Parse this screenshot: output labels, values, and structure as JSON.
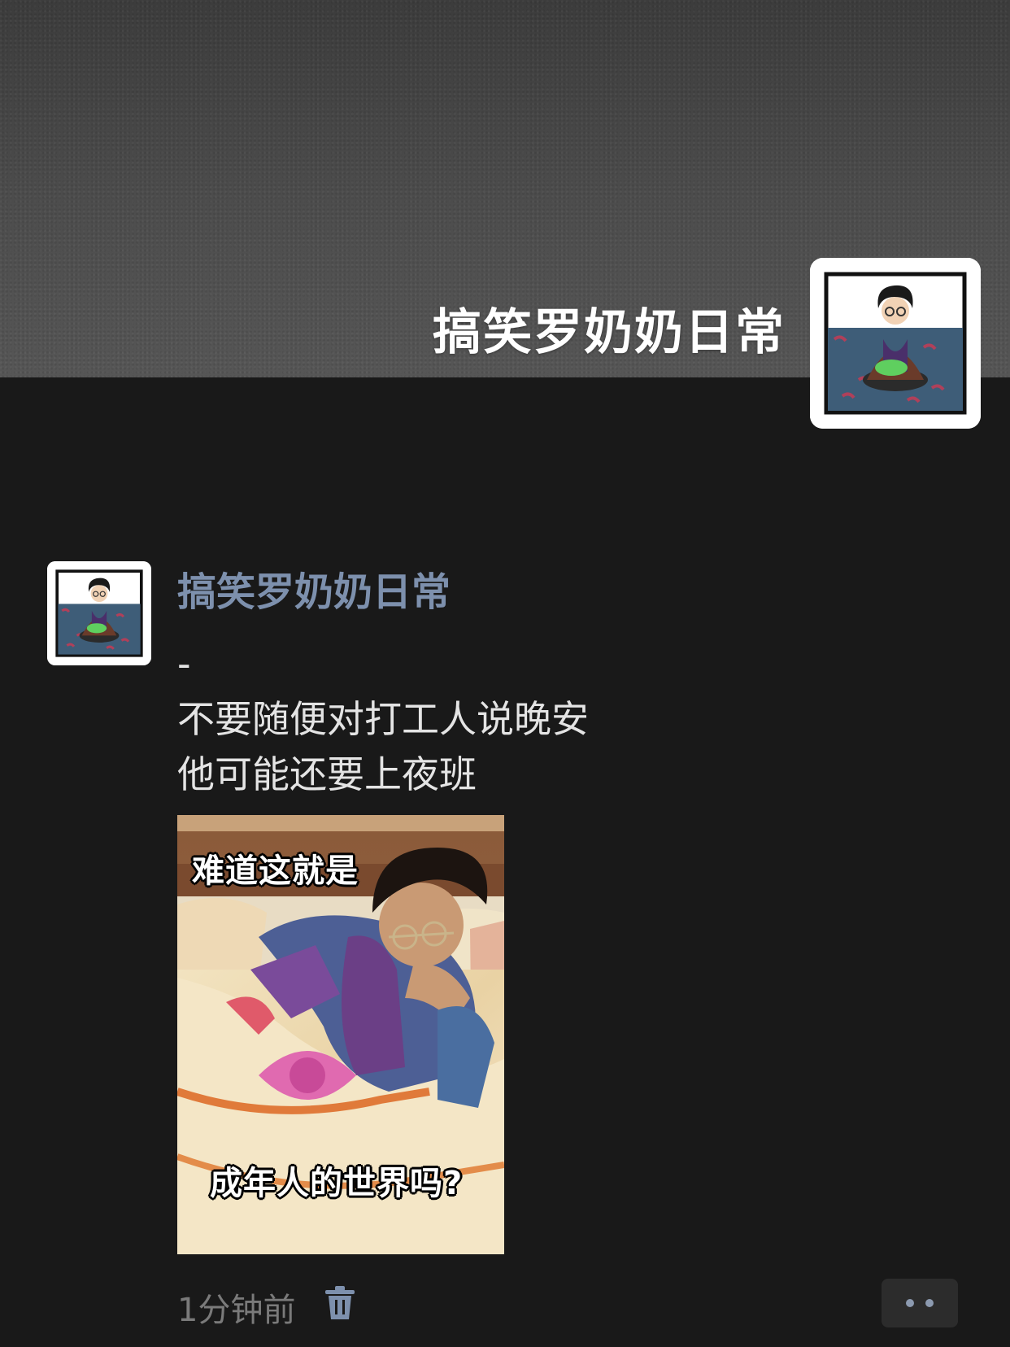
{
  "profile": {
    "name": "搞笑罗奶奶日常"
  },
  "post": {
    "author": "搞笑罗奶奶日常",
    "text": "-\n不要随便对打工人说晚安\n他可能还要上夜班",
    "image": {
      "caption_top": "难道这就是",
      "caption_bottom": "成年人的世界吗?"
    },
    "timestamp": "1分钟前"
  },
  "icons": {
    "delete": "trash-icon",
    "more": "more-dots-icon"
  },
  "colors": {
    "background": "#191919",
    "author_name": "#7d90ad",
    "text": "#e4e4e4",
    "timestamp": "#7a7a7a"
  }
}
